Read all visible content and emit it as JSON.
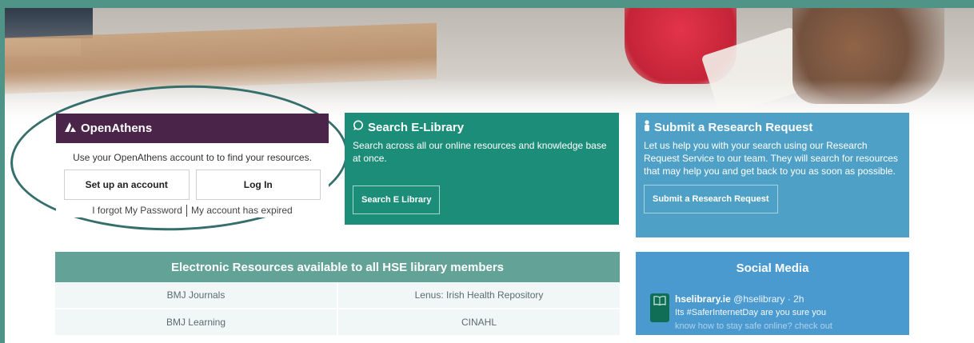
{
  "openathens": {
    "title": "OpenAthens",
    "description": "Use your OpenAthens account to to find your resources.",
    "setup_button": "Set up an account",
    "login_button": "Log In",
    "forgot_link": "I forgot My Password",
    "expired_link": "My account has expired",
    "icon": "openathens-logo-icon"
  },
  "search_elibrary": {
    "title": "Search E-Library",
    "description": "Search across all our online resources and knowledge base at once.",
    "button": "Search E Library",
    "icon": "search-icon"
  },
  "research_request": {
    "title": "Submit a Research Request",
    "description": "Let us help you with your search using our Research Request Service to our team. They will search for resources that may help you and get back to you as soon as possible.",
    "button": "Submit a Research Request",
    "icon": "user-icon"
  },
  "electronic_resources": {
    "title": "Electronic Resources available to all HSE library members",
    "rows": [
      [
        "BMJ Journals",
        "Lenus: Irish Health Repository"
      ],
      [
        "BMJ Learning",
        "CINAHL"
      ]
    ]
  },
  "social_media": {
    "title": "Social Media",
    "tweet": {
      "name": "hselibrary.ie",
      "handle": "@hselibrary",
      "time": "2h",
      "text": "Its #SaferInternetDay are you sure you",
      "text2": "know how to stay safe online? check out"
    }
  },
  "colors": {
    "openathens": "#4a2449",
    "search": "#1c8d78",
    "research": "#4fa0c6",
    "resources_header": "#63a297",
    "social": "#4a9ad0",
    "frame": "#4f9486"
  }
}
